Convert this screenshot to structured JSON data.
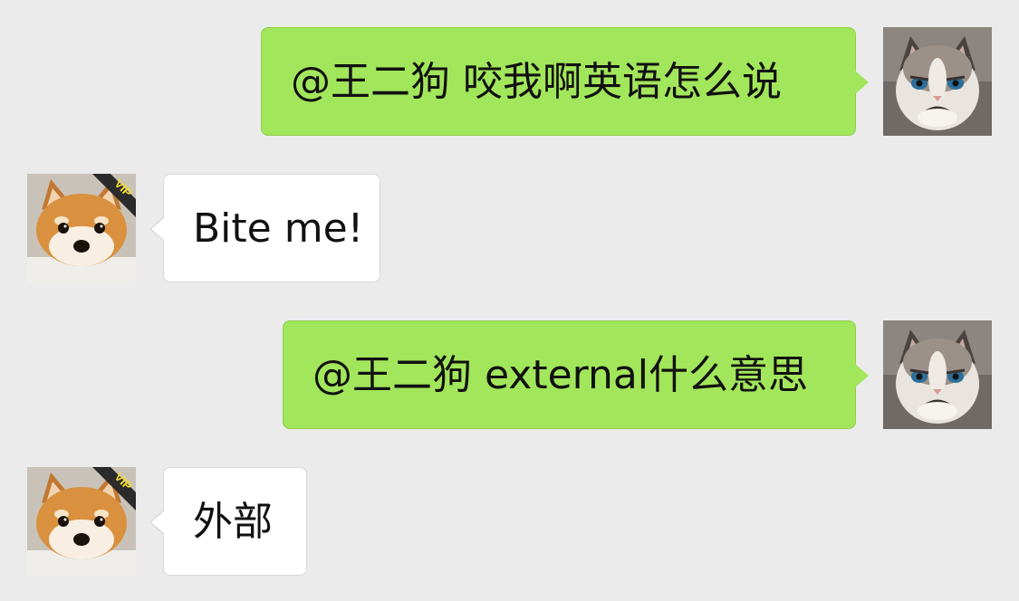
{
  "conversation": {
    "messages": [
      {
        "sender": "me",
        "avatar_icon": "grumpy-cat-avatar-icon",
        "text": "@王二狗 咬我啊英语怎么说"
      },
      {
        "sender": "王二狗",
        "avatar_icon": "shiba-dog-vip-avatar-icon",
        "text": "Bite me!"
      },
      {
        "sender": "me",
        "avatar_icon": "grumpy-cat-avatar-icon",
        "text": "@王二狗 external什么意思"
      },
      {
        "sender": "王二狗",
        "avatar_icon": "shiba-dog-vip-avatar-icon",
        "text": "外部"
      }
    ],
    "badge": "VIP"
  },
  "colors": {
    "background": "#ebebeb",
    "outgoing_bubble": "#a2e65b",
    "incoming_bubble": "#ffffff"
  }
}
